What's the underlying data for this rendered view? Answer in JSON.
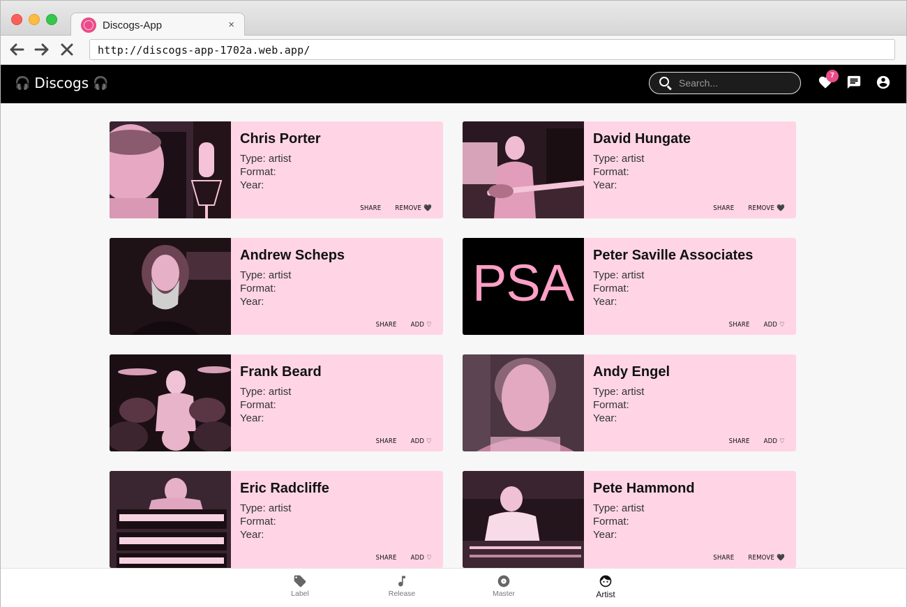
{
  "browser": {
    "tab_title": "Discogs-App",
    "tab_close": "×",
    "url": "http://discogs-app-1702a.web.app/",
    "back_glyph": "🡐",
    "forward_glyph": "🡒",
    "stop_glyph": "✕"
  },
  "header": {
    "brand": "Discogs",
    "brand_icon": "headphones-icon",
    "search_placeholder": "Search...",
    "favorites_count": "7",
    "icons": [
      "heart-icon",
      "chat-icon",
      "account-circle-icon"
    ]
  },
  "cards": [
    {
      "name": "Chris Porter",
      "type": "Type: artist",
      "format": "Format:",
      "year": "Year:",
      "share": "SHARE",
      "action": "REMOVE 🖤"
    },
    {
      "name": "David Hungate",
      "type": "Type: artist",
      "format": "Format:",
      "year": "Year:",
      "share": "SHARE",
      "action": "REMOVE 🖤"
    },
    {
      "name": "Andrew Scheps",
      "type": "Type: artist",
      "format": "Format:",
      "year": "Year:",
      "share": "SHARE",
      "action": "ADD ♡"
    },
    {
      "name": "Peter Saville Associates",
      "type": "Type: artist",
      "format": "Format:",
      "year": "Year:",
      "share": "SHARE",
      "action": "ADD ♡",
      "image_text": "PSA"
    },
    {
      "name": "Frank Beard",
      "type": "Type: artist",
      "format": "Format:",
      "year": "Year:",
      "share": "SHARE",
      "action": "ADD ♡"
    },
    {
      "name": "Andy Engel",
      "type": "Type: artist",
      "format": "Format:",
      "year": "Year:",
      "share": "SHARE",
      "action": "ADD ♡"
    },
    {
      "name": "Eric Radcliffe",
      "type": "Type: artist",
      "format": "Format:",
      "year": "Year:",
      "share": "SHARE",
      "action": "ADD ♡"
    },
    {
      "name": "Pete Hammond",
      "type": "Type: artist",
      "format": "Format:",
      "year": "Year:",
      "share": "SHARE",
      "action": "REMOVE 🖤"
    }
  ],
  "bottom_nav": [
    {
      "label": "Label",
      "icon": "tag-icon",
      "active": false
    },
    {
      "label": "Release",
      "icon": "music-note-icon",
      "active": false
    },
    {
      "label": "Master",
      "icon": "disc-icon",
      "active": false
    },
    {
      "label": "Artist",
      "icon": "face-icon",
      "active": true
    }
  ],
  "colors": {
    "card_bg": "#ffd5e5",
    "accent": "#ea4c89",
    "header_bg": "#000000"
  }
}
